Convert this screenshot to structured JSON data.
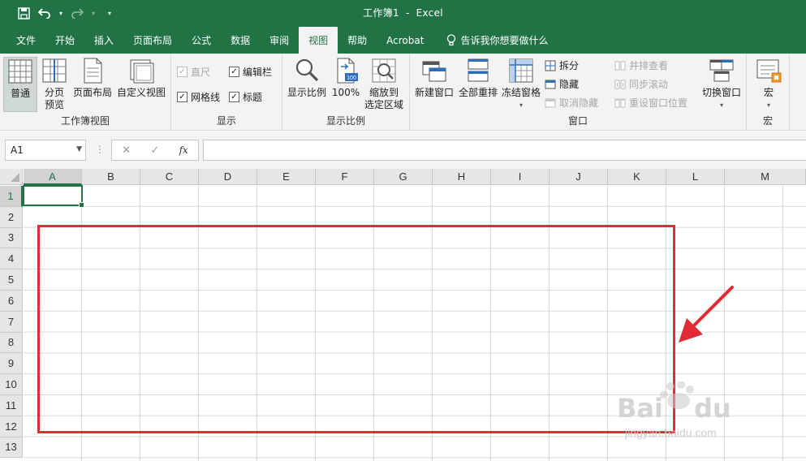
{
  "title_bar": {
    "doc": "工作簿1",
    "separator": "-",
    "app": "Excel"
  },
  "tabs": [
    {
      "label": "文件"
    },
    {
      "label": "开始"
    },
    {
      "label": "插入"
    },
    {
      "label": "页面布局"
    },
    {
      "label": "公式"
    },
    {
      "label": "数据"
    },
    {
      "label": "审阅"
    },
    {
      "label": "视图",
      "active": true
    },
    {
      "label": "帮助"
    },
    {
      "label": "Acrobat"
    }
  ],
  "tell_me": "告诉我你想要做什么",
  "ribbon": {
    "workbook_views": {
      "label": "工作簿视图",
      "normal": "普通",
      "page_break_1": "分页",
      "page_break_2": "预览",
      "page_layout": "页面布局",
      "custom_views": "自定义视图"
    },
    "show": {
      "label": "显示",
      "ruler": "直尺",
      "formula_bar": "编辑栏",
      "gridlines": "网格线",
      "headings": "标题"
    },
    "zoom": {
      "label": "显示比例",
      "zoom": "显示比例",
      "zoom_100": "100%",
      "zoom_sel_1": "缩放到",
      "zoom_sel_2": "选定区域"
    },
    "window": {
      "label": "窗口",
      "new_window": "新建窗口",
      "arrange_all": "全部重排",
      "freeze_panes": "冻结窗格",
      "split": "拆分",
      "hide": "隐藏",
      "unhide": "取消隐藏",
      "side_by_side": "并排查看",
      "sync_scroll": "同步滚动",
      "reset_position": "重设窗口位置",
      "switch_windows": "切换窗口"
    },
    "macros": {
      "label": "宏",
      "macros": "宏"
    }
  },
  "formula_bar": {
    "name_box": "A1",
    "dots": "⋮",
    "fx": "fx",
    "value": ""
  },
  "grid": {
    "columns": [
      "A",
      "B",
      "C",
      "D",
      "E",
      "F",
      "G",
      "H",
      "I",
      "J",
      "K",
      "L",
      "M"
    ],
    "rows": [
      "1",
      "2",
      "3",
      "4",
      "5",
      "6",
      "7",
      "8",
      "9",
      "10",
      "11",
      "12",
      "13"
    ],
    "active_cell": "A1"
  },
  "watermark": {
    "sub": "jingyan.baidu.com"
  },
  "colors": {
    "excel_green": "#217346",
    "annotation_red": "#e22b34"
  }
}
